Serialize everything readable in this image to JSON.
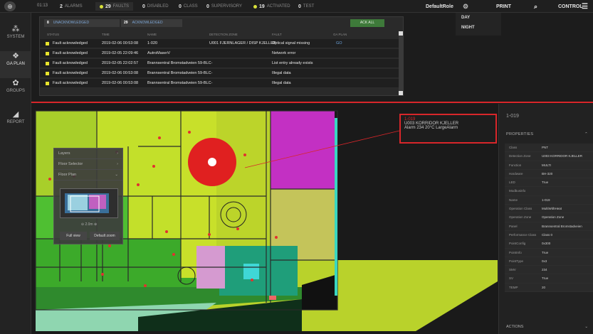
{
  "topbar": {
    "time": "01:13",
    "counters": [
      {
        "count": "2",
        "label": "ALARMS",
        "dot": false,
        "active": false
      },
      {
        "count": "29",
        "label": "FAULTS",
        "dot": true,
        "active": true
      },
      {
        "count": "0",
        "label": "DISABLED",
        "dot": false,
        "active": false
      },
      {
        "count": "0",
        "label": "CLASS",
        "dot": false,
        "active": false
      },
      {
        "count": "0",
        "label": "SUPERVISORY",
        "dot": false,
        "active": false
      },
      {
        "count": "19",
        "label": "ACTIVATED",
        "dot": true,
        "active": false
      },
      {
        "count": "0",
        "label": "TEST",
        "dot": false,
        "active": false
      }
    ],
    "role": "DefaultRole",
    "print": "PRINT",
    "control": "CONTROL",
    "role_options": [
      "DAY",
      "NIGHT"
    ]
  },
  "sidebar": {
    "items": [
      {
        "label": "SYSTEM",
        "icon": "system-icon"
      },
      {
        "label": "GA PLAN",
        "icon": "gaplan-icon"
      },
      {
        "label": "GROUPS",
        "icon": "groups-icon"
      },
      {
        "label": "REPORT",
        "icon": "report-icon"
      }
    ]
  },
  "alarmpanel": {
    "tabs": [
      {
        "count": "8",
        "label": "UNACKNOWLEDGED"
      },
      {
        "count": "29",
        "label": "ACKNOWLEDGED"
      }
    ],
    "ack_all": "ACK ALL",
    "columns": [
      "STATUS",
      "TIME",
      "NAME",
      "DETECTION ZONE",
      "FAULT",
      "GA PLAN"
    ],
    "rows": [
      {
        "status": "Fault acknowledged",
        "time": "2019-02-06 00:53:08",
        "name": "1-020",
        "zone": "U001 FJERNLAGER / DISP KJELLER",
        "fault": "Optical signal missing",
        "plan": "GO"
      },
      {
        "status": "Fault acknowledged",
        "time": "2019-02-05 22:09:46",
        "name": "AutroMaserV",
        "zone": "",
        "fault": "Network error",
        "plan": ""
      },
      {
        "status": "Fault acknowledged",
        "time": "2019-02-05 22:02:57",
        "name": "Brannsentral Bromstadveien 59-BLC-",
        "zone": "",
        "fault": "List entry already exists",
        "plan": ""
      },
      {
        "status": "Fault acknowledged",
        "time": "2019-02-06 00:53:08",
        "name": "Brannsentral Bromstadveien 59-BLC-",
        "zone": "",
        "fault": "Illegal data",
        "plan": ""
      },
      {
        "status": "Fault acknowledged",
        "time": "2019-02-06 00:53:08",
        "name": "Brannsentral Bromstadveien 59-BLC-",
        "zone": "",
        "fault": "Illegal data",
        "plan": ""
      }
    ]
  },
  "floater": {
    "items": [
      "Layers",
      "Floor Selector",
      "Floor Plan"
    ],
    "zoom": "2.0m",
    "full_view": "Full view",
    "default_zoom": "Default zoom"
  },
  "callout": {
    "id": "1-019",
    "zone": "U003 KORRIDOR KJELLER",
    "status": "Alarm  234  20°C  LargeAlarm"
  },
  "rightpanel": {
    "title": "1-019",
    "properties_header": "PROPERTIES",
    "properties": [
      {
        "k": "Class",
        "v": "PNT"
      },
      {
        "k": "Detection Zone",
        "v": "U003 KORRIDOR KJELLER"
      },
      {
        "k": "Function",
        "v": "MULTI"
      },
      {
        "k": "Hardware",
        "v": "BH-320"
      },
      {
        "k": "LED",
        "v": "True"
      },
      {
        "k": "Modbusinfo",
        "v": ""
      },
      {
        "k": "Name",
        "v": "1-019"
      },
      {
        "k": "Operation Class",
        "v": "MultiWithHeat"
      },
      {
        "k": "Operation Zone",
        "v": "Operation Zone"
      },
      {
        "k": "Panel",
        "v": "Brannsentral Bromstadveien"
      },
      {
        "k": "Performance Class",
        "v": "Class 0"
      },
      {
        "k": "PointConfig",
        "v": "0x300"
      },
      {
        "k": "PointInfo",
        "v": "True"
      },
      {
        "k": "PointType",
        "v": "0x3"
      },
      {
        "k": "SMV",
        "v": "234"
      },
      {
        "k": "SV",
        "v": "True"
      },
      {
        "k": "TEMP",
        "v": "20"
      }
    ],
    "actions_header": "ACTIONS"
  }
}
